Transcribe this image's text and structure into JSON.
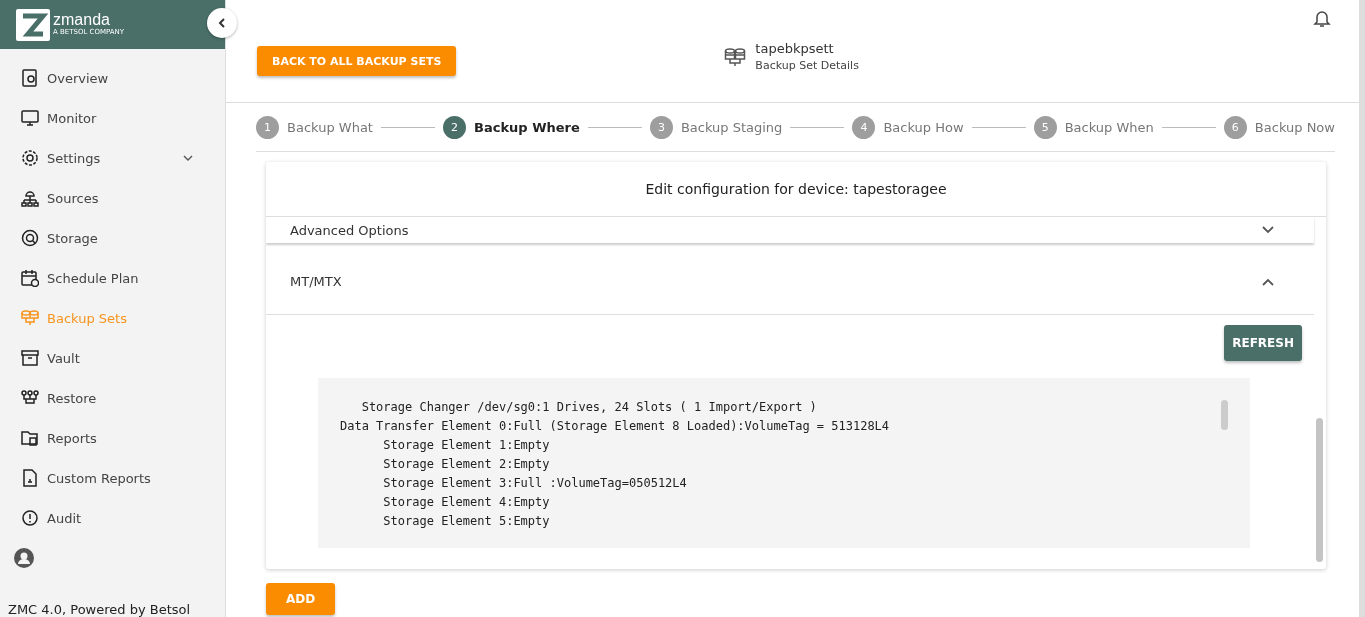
{
  "sidebar": {
    "logo": {
      "wordmark": "zmanda",
      "tagline": "A BETSOL COMPANY"
    },
    "items": [
      {
        "label": "Overview",
        "selected": false,
        "submenu": false
      },
      {
        "label": "Monitor",
        "selected": false,
        "submenu": false
      },
      {
        "label": "Settings",
        "selected": false,
        "submenu": true
      },
      {
        "label": "Sources",
        "selected": false,
        "submenu": false
      },
      {
        "label": "Storage",
        "selected": false,
        "submenu": false
      },
      {
        "label": "Schedule Plan",
        "selected": false,
        "submenu": false
      },
      {
        "label": "Backup Sets",
        "selected": true,
        "submenu": false
      },
      {
        "label": "Vault",
        "selected": false,
        "submenu": false
      },
      {
        "label": "Restore",
        "selected": false,
        "submenu": false
      },
      {
        "label": "Reports",
        "selected": false,
        "submenu": false
      },
      {
        "label": "Custom Reports",
        "selected": false,
        "submenu": false
      },
      {
        "label": "Audit",
        "selected": false,
        "submenu": false
      }
    ],
    "footer": "ZMC 4.0, Powered by Betsol"
  },
  "header": {
    "back_button": "BACK TO ALL BACKUP SETS",
    "set_name": "tapebkpsett",
    "set_subtitle": "Backup Set Details"
  },
  "steps": [
    {
      "number": "1",
      "label": "Backup What",
      "selected": false
    },
    {
      "number": "2",
      "label": "Backup Where",
      "selected": true
    },
    {
      "number": "3",
      "label": "Backup Staging",
      "selected": false
    },
    {
      "number": "4",
      "label": "Backup How",
      "selected": false
    },
    {
      "number": "5",
      "label": "Backup When",
      "selected": false
    },
    {
      "number": "6",
      "label": "Backup Now",
      "selected": false
    }
  ],
  "dialog": {
    "title": "Edit configuration for device: tapestoragee",
    "sections": [
      {
        "title": "Advanced Options",
        "expanded": false
      },
      {
        "title": "MT/MTX",
        "expanded": true
      }
    ],
    "refresh_button": "REFRESH",
    "output_lines": [
      "   Storage Changer /dev/sg0:1 Drives, 24 Slots ( 1 Import/Export )",
      "Data Transfer Element 0:Full (Storage Element 8 Loaded):VolumeTag = 513128L4",
      "      Storage Element 1:Empty",
      "      Storage Element 2:Empty",
      "      Storage Element 3:Full :VolumeTag=050512L4",
      "      Storage Element 4:Empty",
      "      Storage Element 5:Empty"
    ]
  },
  "add_button": "ADD"
}
